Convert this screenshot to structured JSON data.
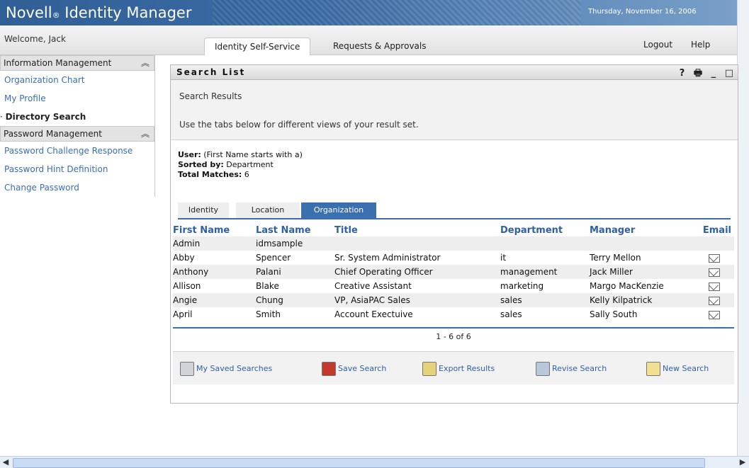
{
  "app": {
    "brand": "Novell",
    "brand_reg": "®",
    "brand_product": " Identity Manager",
    "date": "Thursday, November 16, 2006"
  },
  "nav": {
    "welcome": "Welcome, Jack",
    "tabs": [
      "Identity Self-Service",
      "Requests & Approvals"
    ],
    "active_tab": "Identity Self-Service",
    "logout": "Logout",
    "help": "Help"
  },
  "sidebar": {
    "sections": [
      {
        "title": "Information Management",
        "items": [
          "Organization Chart",
          "My Profile",
          "Directory Search"
        ]
      },
      {
        "title": "Password Management",
        "items": [
          "Password Challenge Response",
          "Password Hint Definition",
          "Change Password"
        ]
      }
    ],
    "current_item": "Directory Search"
  },
  "portlet": {
    "title": "Search List",
    "controls": [
      "?",
      "🖶",
      "_",
      "□"
    ],
    "intro_line1": "Search Results",
    "intro_line2": "Use the tabs below for different views of your result set.",
    "user_label": "User:",
    "user_value": " (First Name starts with a)",
    "sorted_label": "Sorted by:",
    "sorted_value": " Department",
    "total_label": "Total Matches:",
    "total_value": " 6",
    "result_tabs": [
      "Identity",
      "Location",
      "Organization"
    ],
    "active_result_tab": "Organization",
    "columns": [
      "First Name",
      "Last Name",
      "Title",
      "Department",
      "Manager",
      "Email"
    ],
    "rows": [
      [
        "Admin",
        "idmsample",
        "",
        "",
        "",
        ""
      ],
      [
        "Abby",
        "Spencer",
        "Sr. System Administrator",
        "it",
        "Terry Mellon",
        "envelope"
      ],
      [
        "Anthony",
        "Palani",
        "Chief Operating Officer",
        "management",
        "Jack Miller",
        "envelope"
      ],
      [
        "Allison",
        "Blake",
        "Creative Assistant",
        "marketing",
        "Margo MacKenzie",
        "envelope"
      ],
      [
        "Angie",
        "Chung",
        "VP, AsiaPAC Sales",
        "sales",
        "Kelly Kilpatrick",
        "envelope"
      ],
      [
        "April",
        "Smith",
        "Account Exectuive",
        "sales",
        "Sally South",
        "envelope"
      ]
    ],
    "paging": "1 - 6 of 6",
    "actions": [
      "My Saved Searches",
      "Save Search",
      "Export Results",
      "Revise Search",
      "New Search"
    ]
  }
}
